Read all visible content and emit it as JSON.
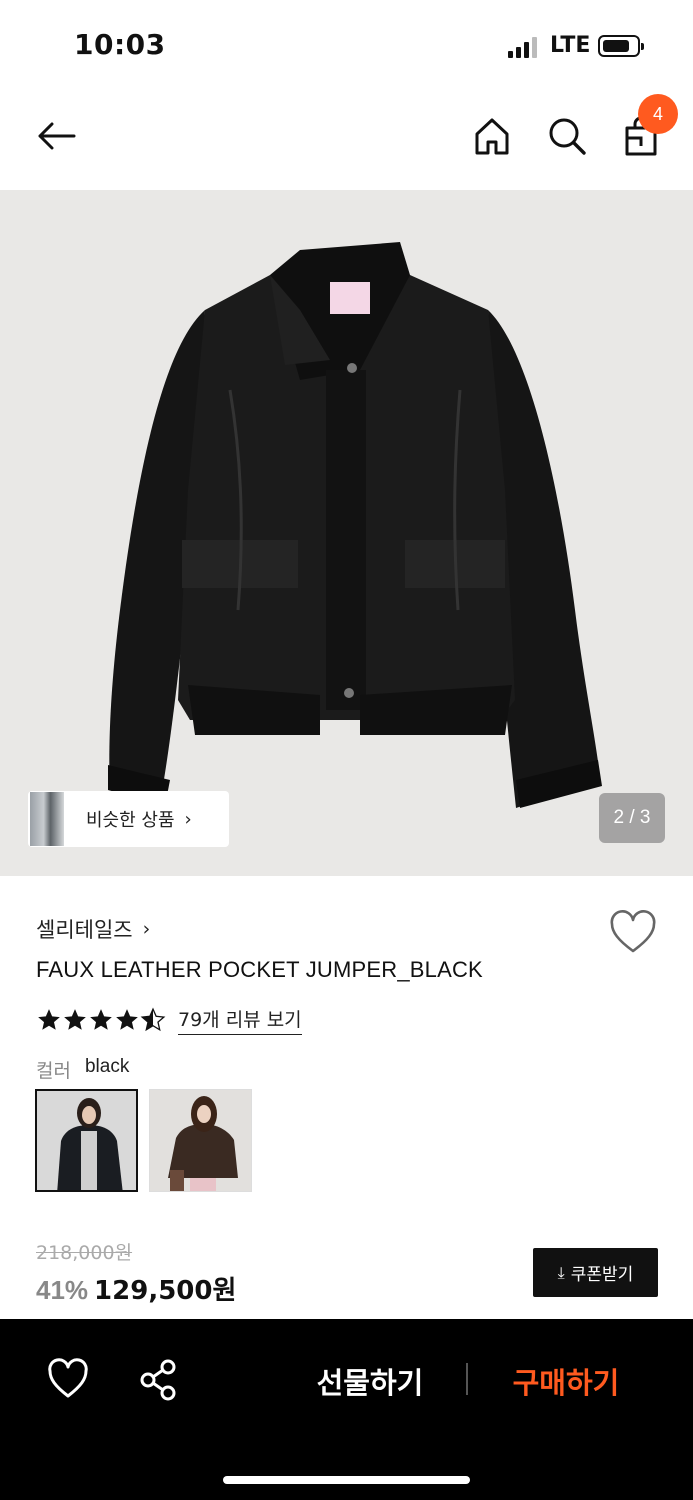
{
  "status_bar": {
    "time": "10:03",
    "network": "LTE"
  },
  "header": {
    "cart_count": "4"
  },
  "gallery": {
    "similar_label": "비슷한 상품",
    "similar_chevron": "›",
    "page_indicator": "2 / 3"
  },
  "product": {
    "brand": "셀리테일즈",
    "brand_chevron": "›",
    "title": "FAUX LEATHER POCKET JUMPER_BLACK",
    "rating": 4.5,
    "review_link": "79개 리뷰 보기",
    "color_label": "컬러",
    "color_value": "black",
    "original_price": "218,000원",
    "discount": "41%",
    "sale_price": "129,500원",
    "coupon_label": "쿠폰받기",
    "coupon_icon": "⤓"
  },
  "bottom_bar": {
    "gift_label": "선물하기",
    "buy_label": "구매하기"
  },
  "colors": {
    "accent": "#ff5a1f",
    "bottom_bar_bg": "#000000",
    "gallery_bg": "#e9e8e6"
  },
  "icons": [
    "back-arrow-icon",
    "home-icon",
    "search-icon",
    "shopping-bag-icon",
    "heart-icon",
    "share-icon",
    "download-icon",
    "star-icon"
  ]
}
